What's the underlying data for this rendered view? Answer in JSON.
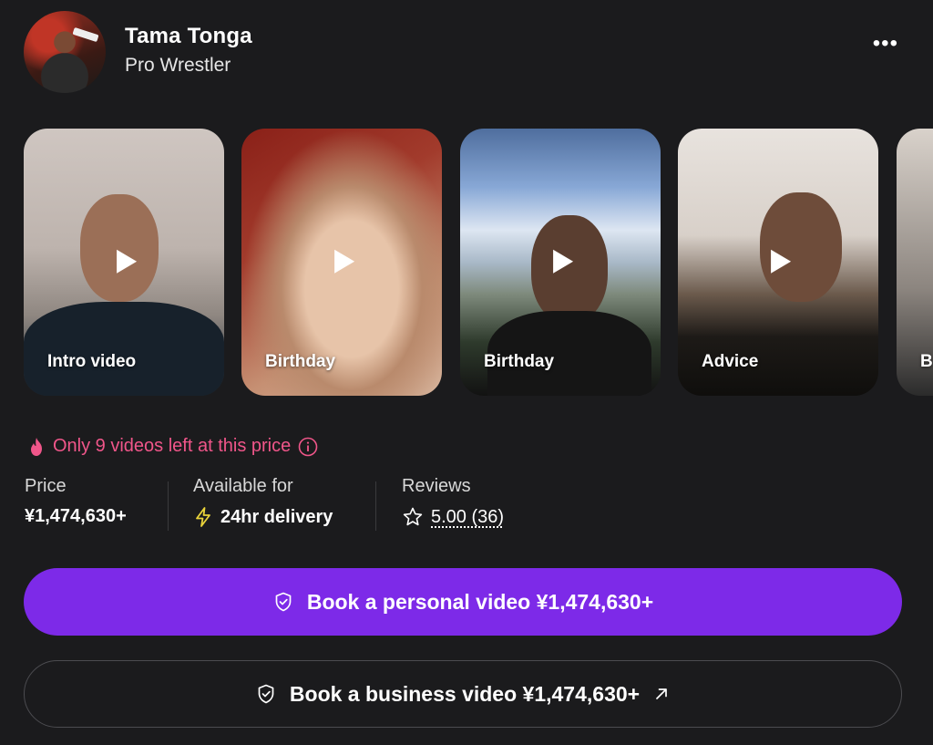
{
  "profile": {
    "name": "Tama Tonga",
    "title": "Pro Wrestler",
    "more_label": "•••"
  },
  "videos": [
    {
      "caption": "Intro video"
    },
    {
      "caption": "Birthday"
    },
    {
      "caption": "Birthday"
    },
    {
      "caption": "Advice"
    },
    {
      "caption": "B"
    }
  ],
  "scarcity": {
    "text": "Only 9 videos left at this price",
    "color": "#f0568a"
  },
  "stats": {
    "price": {
      "label": "Price",
      "value": "¥1,474,630+"
    },
    "availability": {
      "label": "Available for",
      "value": "24hr delivery"
    },
    "reviews": {
      "label": "Reviews",
      "value": "5.00 (36)"
    }
  },
  "actions": {
    "personal": {
      "label": "Book a personal video ¥1,474,630+",
      "color": "#7d2ae8"
    },
    "business": {
      "label": "Book a business video ¥1,474,630+"
    }
  }
}
